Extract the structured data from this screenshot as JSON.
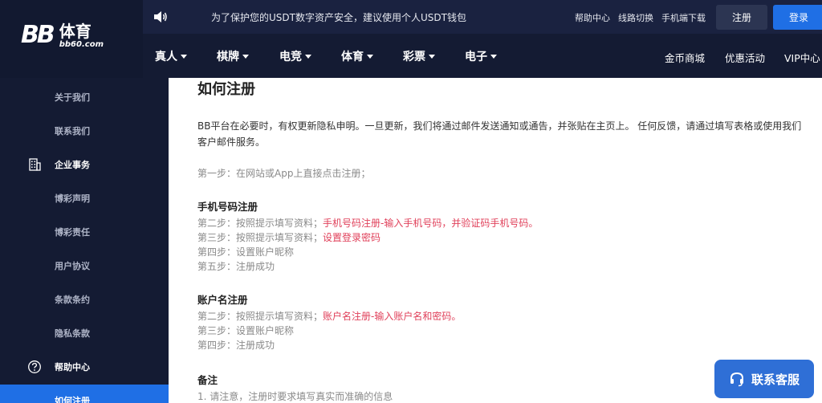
{
  "brand": {
    "logo_mark": "BB",
    "logo_title": "体育",
    "logo_sub": "bb60.com"
  },
  "notice": {
    "icon": "speaker-icon",
    "text": "为了保护您的USDT数字资产安全，建议使用个人USDT钱包"
  },
  "top_links": [
    "帮助中心",
    "线路切换",
    "手机端下载"
  ],
  "auth": {
    "register": "注册",
    "login": "登录"
  },
  "nav": {
    "items": [
      "真人",
      "棋牌",
      "电竞",
      "体育",
      "彩票",
      "电子"
    ],
    "right": [
      "金币商城",
      "优惠活动",
      "VIP中心"
    ]
  },
  "sidebar": {
    "items": [
      {
        "label": "关于我们"
      },
      {
        "label": "联系我们"
      },
      {
        "label": "企业事务",
        "icon": "building-icon"
      },
      {
        "label": "博彩声明"
      },
      {
        "label": "博彩责任"
      },
      {
        "label": "用户协议"
      },
      {
        "label": "条款条约"
      },
      {
        "label": "隐私条款"
      },
      {
        "label": "帮助中心",
        "icon": "question-circle-icon"
      },
      {
        "label": "如何注册"
      }
    ]
  },
  "content": {
    "title": "如何注册",
    "intro": "BB平台在必要时，有权更新隐私申明。一旦更新，我们将通过邮件发送通知或通告，并张贴在主页上。 任何反馈，请通过填写表格或使用我们客户邮件服务。",
    "step1": "第一步：在网站或App上直接点击注册；",
    "phone": {
      "heading": "手机号码注册",
      "step2_prefix": "第二步：按照提示填写资料；",
      "step2_highlight": "手机号码注册-输入手机号码，并验证码手机号码。",
      "step3_prefix": "第三步：按照提示填写资料；",
      "step3_highlight": "设置登录密码",
      "step4": "第四步：设置账户昵称",
      "step5": "第五步：注册成功"
    },
    "account": {
      "heading": "账户名注册",
      "step2_prefix": "第二步：按照提示填写资料；",
      "step2_highlight": "账户名注册-输入账户名和密码。",
      "step3": "第三步：设置账户昵称",
      "step4": "第四步：注册成功"
    },
    "note": {
      "heading": "备注",
      "line1": "1. 请注意，注册时要求填写真实而准确的信息"
    }
  },
  "chat": {
    "label": "联系客服",
    "icon": "headset-icon"
  },
  "colors": {
    "header": "#141b33",
    "accent": "#1f6fe5",
    "highlight": "#e0405a"
  }
}
